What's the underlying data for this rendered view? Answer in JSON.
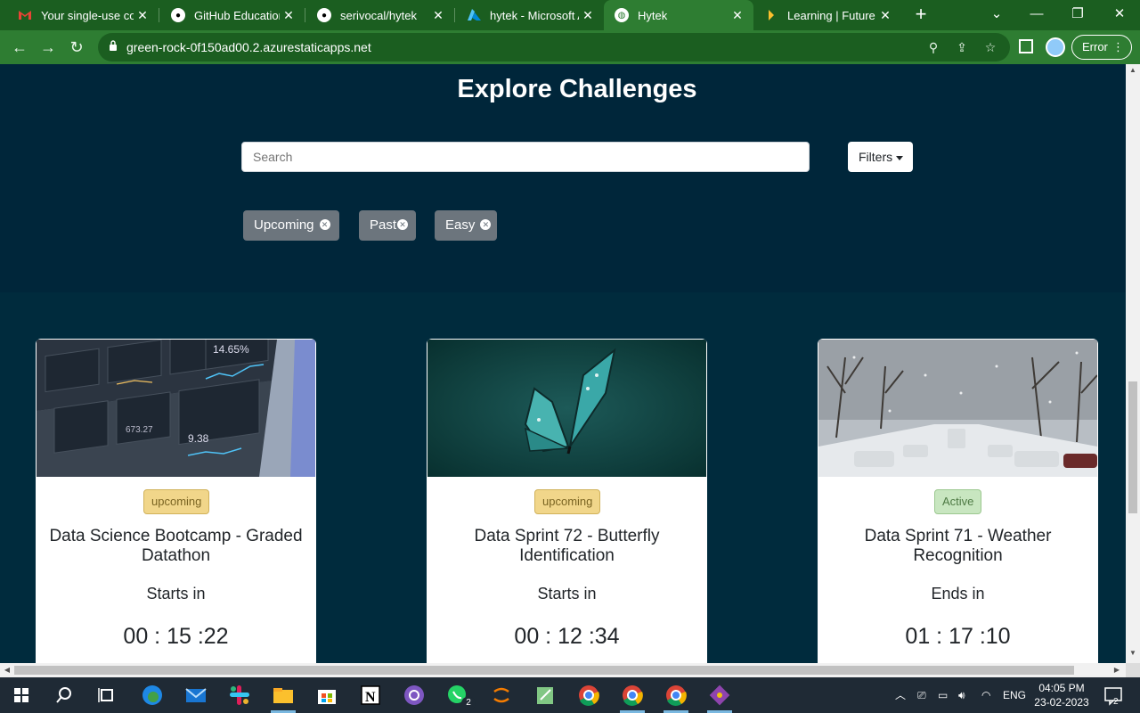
{
  "browser": {
    "tabs": [
      {
        "title": "Your single-use code",
        "favicon": "gmail-icon",
        "color": "#d93025"
      },
      {
        "title": "GitHub Education",
        "favicon": "github-icon",
        "color": "#000000"
      },
      {
        "title": "serivocal/hytek",
        "favicon": "github-icon",
        "color": "#000000"
      },
      {
        "title": "hytek - Microsoft Azure",
        "favicon": "azure-icon",
        "color": "#0089d6"
      },
      {
        "title": "Hytek",
        "favicon": "globe-icon",
        "color": "#ffffff"
      },
      {
        "title": "Learning | Future Ready",
        "favicon": "learning-icon",
        "color": "#fbc02d"
      }
    ],
    "url": "green-rock-0f150ad00.2.azurestaticapps.net",
    "error_label": "Error"
  },
  "page": {
    "heading": "Explore Challenges",
    "search_placeholder": "Search",
    "filters_label": "Filters",
    "chips": [
      "Upcoming",
      "Past",
      "Easy"
    ],
    "cards": [
      {
        "status": "upcoming",
        "title": "Data Science Bootcamp - Graded Datathon",
        "label": "Starts in",
        "timer": "00 : 15 :22",
        "image": "dashboard-screen-image"
      },
      {
        "status": "upcoming",
        "title": "Data Sprint 72 - Butterfly Identification",
        "label": "Starts in",
        "timer": "00 : 12 :34",
        "image": "butterfly-image"
      },
      {
        "status": "Active",
        "title": "Data Sprint 71 - Weather Recognition",
        "label": "Ends in",
        "timer": "01 : 17 :10",
        "image": "snowy-street-image"
      }
    ]
  },
  "taskbar": {
    "language": "ENG",
    "time": "04:05 PM",
    "date": "23-02-2023",
    "whatsapp_badge": "2",
    "notification_count": "2"
  }
}
